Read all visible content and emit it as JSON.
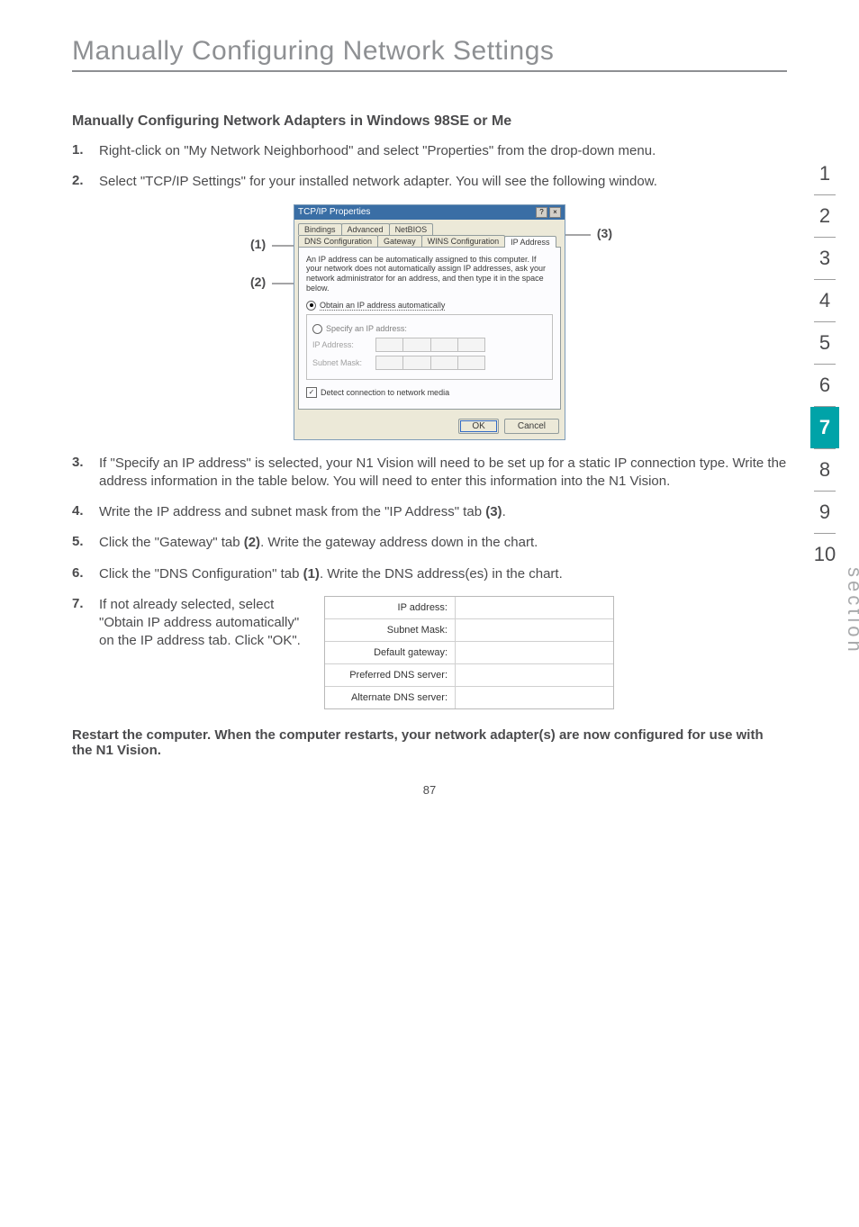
{
  "chapter_title": "Manually Configuring Network Settings",
  "subhead": "Manually Configuring Network Adapters in Windows 98SE or Me",
  "steps": {
    "s1": {
      "n": "1.",
      "t": "Right-click on \"My Network Neighborhood\" and select \"Properties\" from the drop-down menu."
    },
    "s2": {
      "n": "2.",
      "t": "Select \"TCP/IP Settings\" for your installed network adapter. You will see the following window."
    },
    "s3": {
      "n": "3.",
      "t": "If \"Specify an IP address\" is selected, your N1 Vision will need to be set up for a static IP connection type. Write the address information in the table below. You will need to enter this information into the N1 Vision."
    },
    "s4": {
      "n": "4.",
      "t1": "Write the IP address and subnet mask from the \"IP Address\" tab ",
      "bold": "(3)",
      "t2": "."
    },
    "s5": {
      "n": "5.",
      "t1": "Click the \"Gateway\" tab ",
      "bold": "(2)",
      "t2": ". Write the gateway address down in the chart."
    },
    "s6": {
      "n": "6.",
      "t1": "Click the \"DNS Configuration\" tab ",
      "bold": "(1)",
      "t2": ". Write the DNS address(es) in the chart."
    },
    "s7": {
      "n": "7.",
      "t": "If not already selected, select \"Obtain IP address automatically\" on the IP address tab. Click \"OK\"."
    }
  },
  "restart_note": "Restart the computer. When the computer restarts, your network adapter(s) are now configured for use with the N1 Vision.",
  "page_number": "87",
  "side": {
    "tabs": [
      "1",
      "2",
      "3",
      "4",
      "5",
      "6",
      "7",
      "8",
      "9",
      "10"
    ],
    "active_index": 6,
    "section_label": "section"
  },
  "dialog": {
    "title": "TCP/IP Properties",
    "help_btn": "?",
    "close_btn": "×",
    "tabs_row1": [
      "Bindings",
      "Advanced",
      "NetBIOS"
    ],
    "tabs_row2": [
      "DNS Configuration",
      "Gateway",
      "WINS Configuration",
      "IP Address"
    ],
    "desc": "An IP address can be automatically assigned to this computer. If your network does not automatically assign IP addresses, ask your network administrator for an address, and then type it in the space below.",
    "rb1": "Obtain an IP address automatically",
    "rb2": "Specify an IP address:",
    "ip_label": "IP Address:",
    "subnet_label": "Subnet Mask:",
    "detect_label": "Detect connection to network media",
    "ok": "OK",
    "cancel": "Cancel"
  },
  "callouts": {
    "c1": "(1)",
    "c2": "(2)",
    "c3": "(3)"
  },
  "net_table": {
    "r1": "IP address:",
    "r2": "Subnet Mask:",
    "r3": "Default gateway:",
    "r4": "Preferred DNS server:",
    "r5": "Alternate DNS server:"
  }
}
